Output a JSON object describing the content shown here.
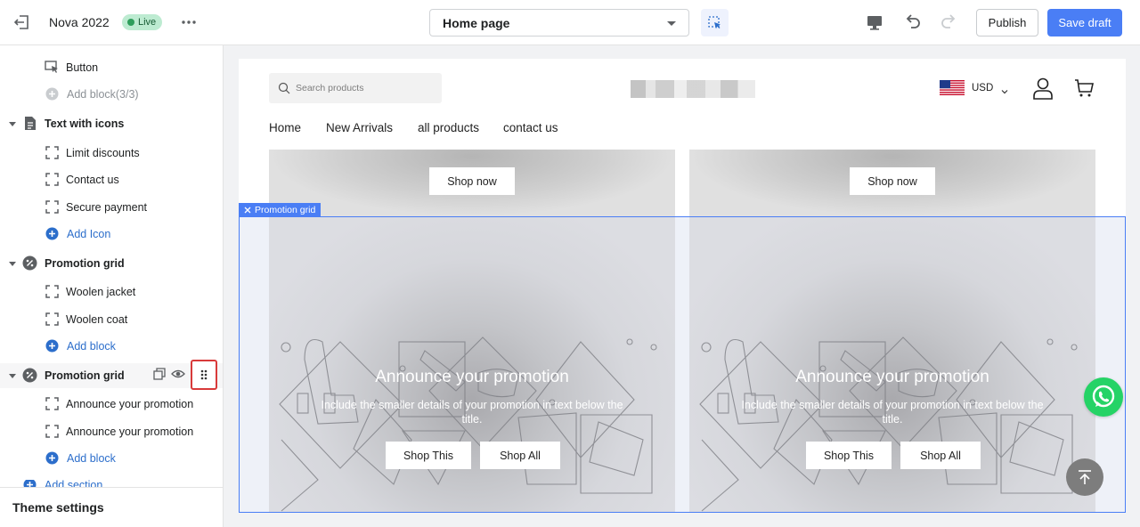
{
  "topbar": {
    "store_name": "Nova 2022",
    "live_badge": "Live",
    "page_select": "Home page",
    "publish_label": "Publish",
    "save_label": "Save draft",
    "icons": [
      "exit-icon",
      "more-icon",
      "inspector-icon",
      "desktop-icon",
      "undo-icon",
      "redo-icon"
    ]
  },
  "sidebar": {
    "items": [
      {
        "label": "Button",
        "kind": "block",
        "icon": "cursor-icon"
      },
      {
        "label": "Add block(3/3)",
        "kind": "add-disabled"
      },
      {
        "label": "Text with icons",
        "kind": "section",
        "icon": "text-icon"
      },
      {
        "label": "Limit discounts",
        "kind": "block",
        "icon": "block-icon"
      },
      {
        "label": "Contact us",
        "kind": "block",
        "icon": "block-icon"
      },
      {
        "label": "Secure payment",
        "kind": "block",
        "icon": "block-icon"
      },
      {
        "label": "Add Icon",
        "kind": "add"
      },
      {
        "label": "Promotion grid",
        "kind": "section",
        "icon": "percent-icon"
      },
      {
        "label": "Woolen jacket",
        "kind": "block",
        "icon": "block-icon"
      },
      {
        "label": "Woolen coat",
        "kind": "block",
        "icon": "block-icon"
      },
      {
        "label": "Add block",
        "kind": "add"
      },
      {
        "label": "Promotion grid",
        "kind": "section",
        "icon": "percent-icon",
        "selected": true
      },
      {
        "label": "Announce your promotion",
        "kind": "block",
        "icon": "block-icon"
      },
      {
        "label": "Announce your promotion",
        "kind": "block",
        "icon": "block-icon"
      },
      {
        "label": "Add block",
        "kind": "add"
      }
    ],
    "add_section": "Add section",
    "theme_settings": "Theme settings"
  },
  "store": {
    "search_placeholder": "Search products",
    "currency": "USD",
    "nav": [
      "Home",
      "New Arrivals",
      "all products",
      "contact us"
    ],
    "banners": [
      {
        "button": "Shop now"
      },
      {
        "button": "Shop now"
      }
    ],
    "promo_tag": "Promotion grid",
    "promos": [
      {
        "title": "Announce your promotion",
        "subtitle": "Include the smaller details of your promotion in text below the title.",
        "btn1": "Shop This",
        "btn2": "Shop All"
      },
      {
        "title": "Announce your promotion",
        "subtitle": "Include the smaller details of your promotion in text below the title.",
        "btn1": "Shop This",
        "btn2": "Shop All"
      }
    ]
  },
  "colors": {
    "accent": "#4a7ef5",
    "live_bg": "#bdebd1",
    "highlight_border": "#d83a3a",
    "whatsapp": "#25d366"
  }
}
